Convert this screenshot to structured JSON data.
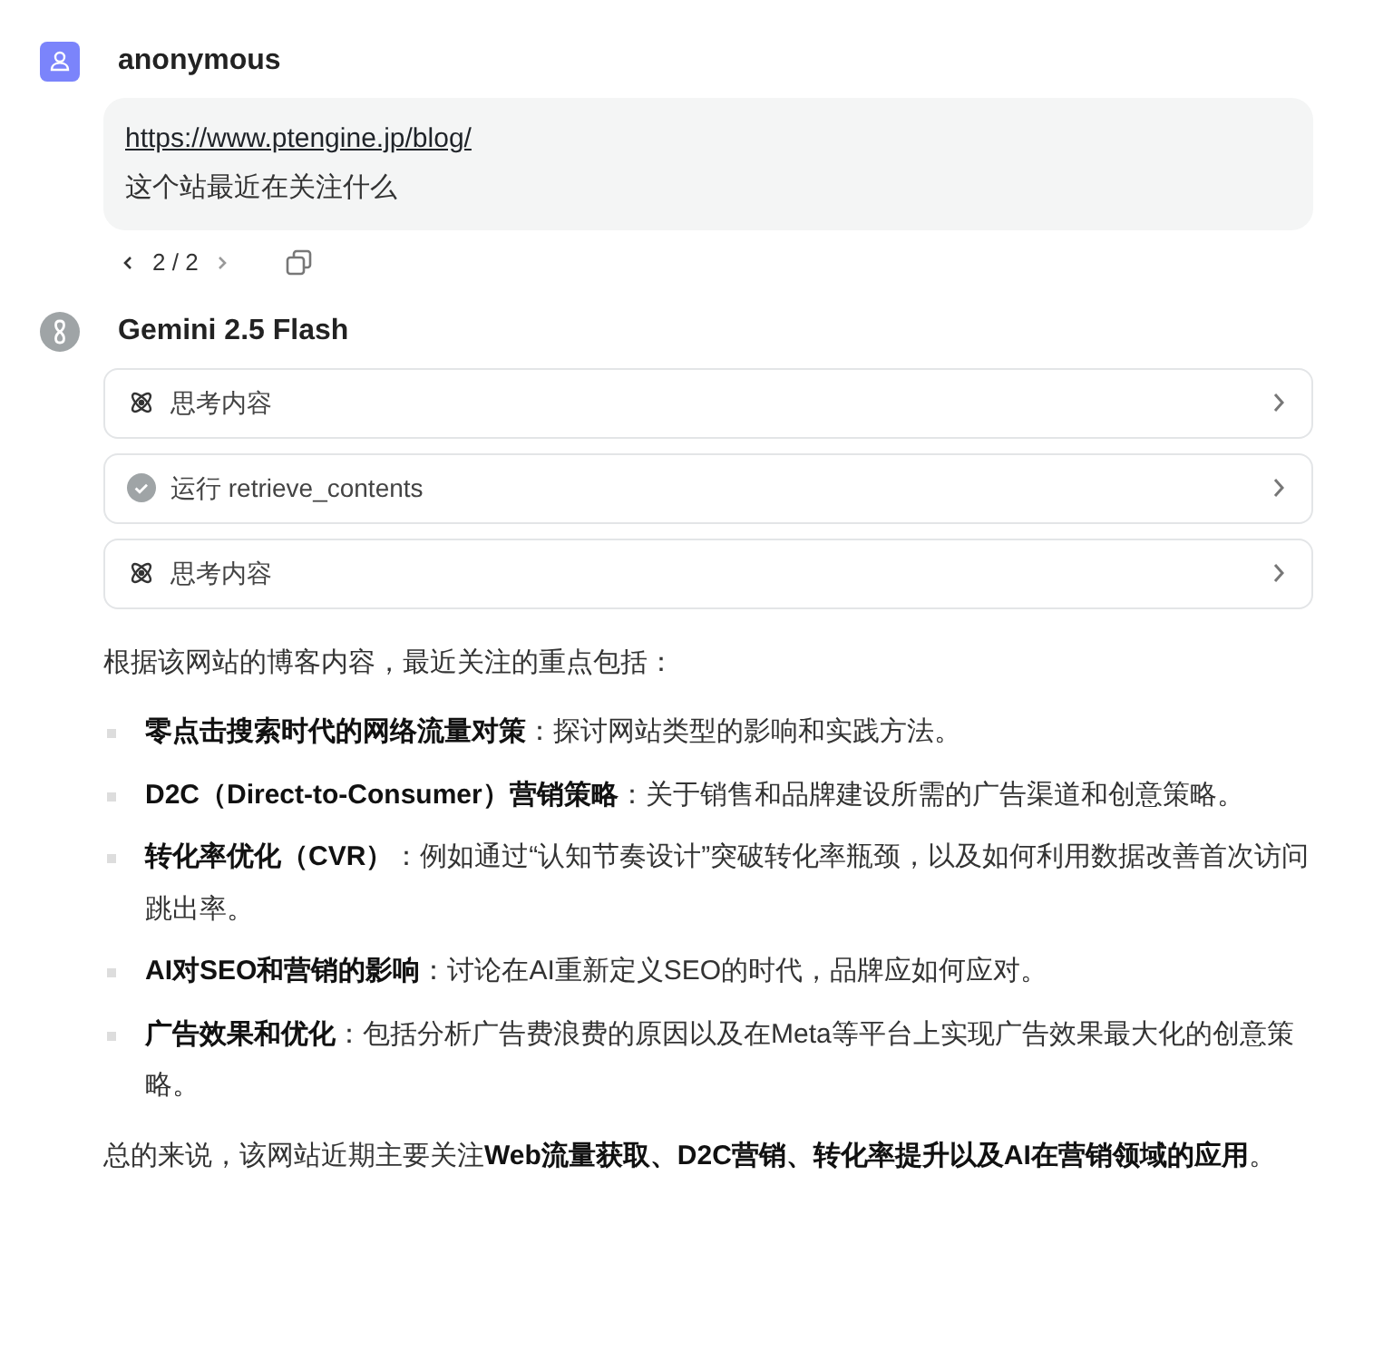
{
  "user": {
    "name": "anonymous",
    "link": "https://www.ptengine.jp/blog/",
    "question": "这个站最近在关注什么",
    "pager": "2 / 2"
  },
  "assistant": {
    "name": "Gemini 2.5 Flash",
    "steps": [
      {
        "kind": "think",
        "label": "思考内容"
      },
      {
        "kind": "tool",
        "label": "运行 retrieve_contents"
      },
      {
        "kind": "think",
        "label": "思考内容"
      }
    ],
    "intro": "根据该网站的博客内容，最近关注的重点包括：",
    "bullets": [
      "**零点击搜索时代的网络流量对策**：探讨网站类型的影响和实践方法。",
      "**D2C（Direct-to-Consumer）营销策略**：关于销售和品牌建设所需的广告渠道和创意策略。",
      "**转化率优化（CVR）**：例如通过“认知节奏设计”突破转化率瓶颈，以及如何利用数据改善首次访问跳出率。",
      "**AI对SEO和营销的影响**：讨论在AI重新定义SEO的时代，品牌应如何应对。",
      "**广告效果和优化**：包括分析广告费浪费的原因以及在Meta等平台上实现广告效果最大化的创意策略。"
    ],
    "summary": "总的来说，该网站近期主要关注**Web流量获取、D2C营销、转化率提升以及AI在营销领域的应用**。"
  }
}
